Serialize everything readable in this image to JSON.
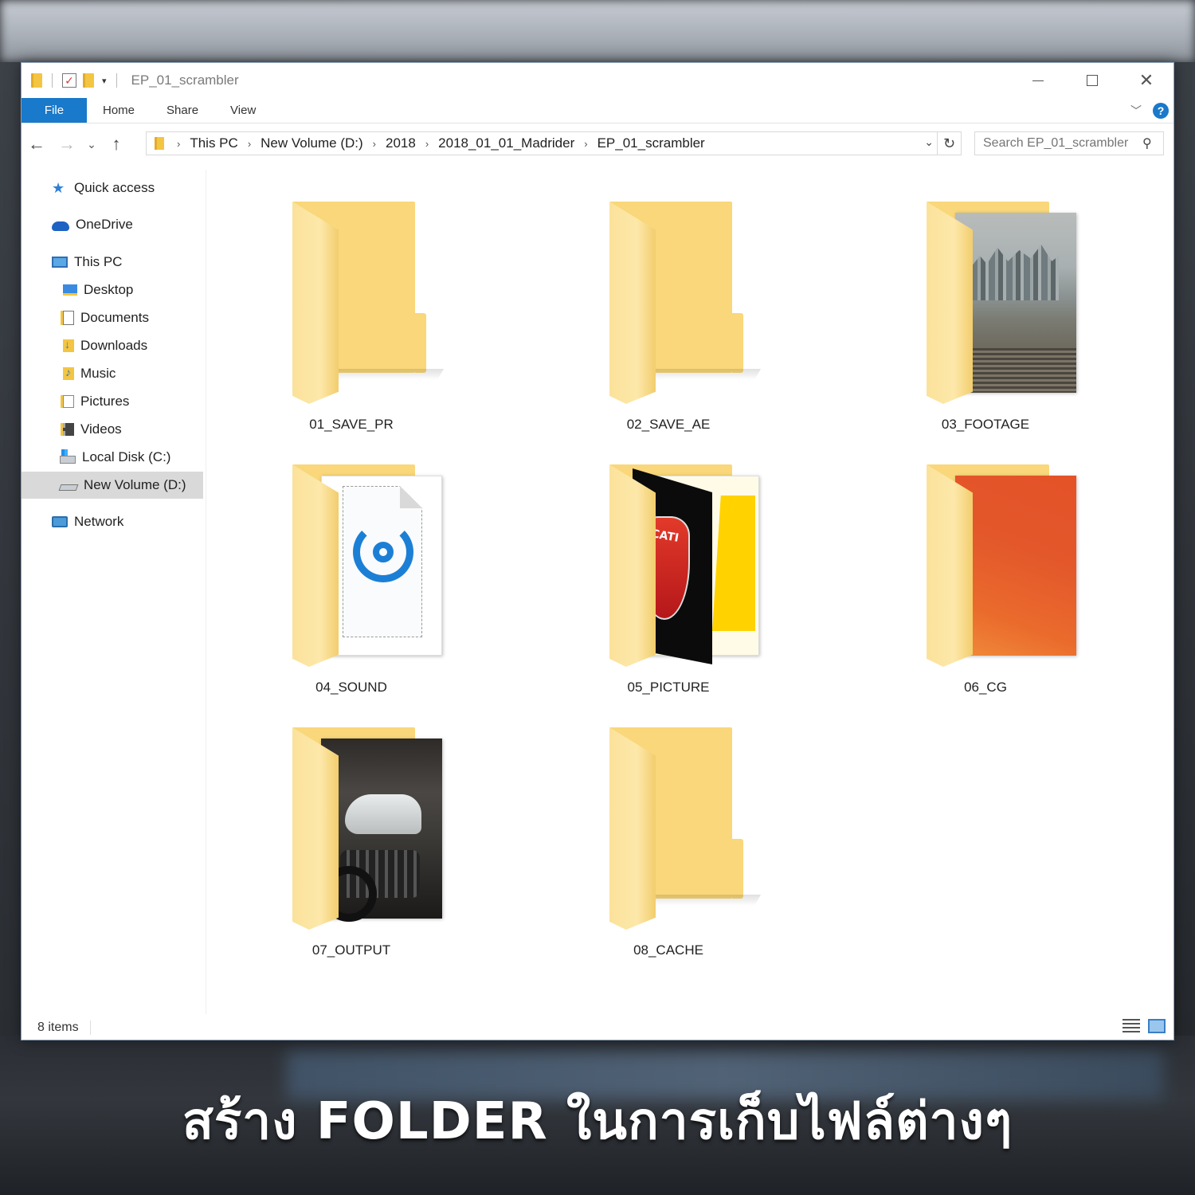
{
  "window": {
    "title": "EP_01_scrambler"
  },
  "ribbon": {
    "tabs": [
      "File",
      "Home",
      "Share",
      "View"
    ]
  },
  "address": {
    "crumbs": [
      "This PC",
      "New Volume (D:)",
      "2018",
      "2018_01_01_Madrider",
      "EP_01_scrambler"
    ]
  },
  "search": {
    "placeholder": "Search EP_01_scrambler"
  },
  "sidebar": {
    "items": [
      {
        "label": "Quick access",
        "icon": "quick-access-star-icon"
      },
      {
        "label": "OneDrive",
        "icon": "onedrive-cloud-icon"
      },
      {
        "label": "This PC",
        "icon": "this-pc-icon"
      },
      {
        "label": "Desktop",
        "icon": "desktop-folder-icon"
      },
      {
        "label": "Documents",
        "icon": "documents-folder-icon"
      },
      {
        "label": "Downloads",
        "icon": "downloads-folder-icon"
      },
      {
        "label": "Music",
        "icon": "music-folder-icon"
      },
      {
        "label": "Pictures",
        "icon": "pictures-folder-icon"
      },
      {
        "label": "Videos",
        "icon": "videos-folder-icon"
      },
      {
        "label": "Local Disk (C:)",
        "icon": "local-disk-icon"
      },
      {
        "label": "New Volume (D:)",
        "icon": "drive-icon",
        "selected": true
      },
      {
        "label": "Network",
        "icon": "network-icon"
      }
    ]
  },
  "content": {
    "folders": [
      {
        "name": "01_SAVE_PR",
        "thumbnail": "none"
      },
      {
        "name": "02_SAVE_AE",
        "thumbnail": "none"
      },
      {
        "name": "03_FOOTAGE",
        "thumbnail": "city-photo"
      },
      {
        "name": "04_SOUND",
        "thumbnail": "audio-document"
      },
      {
        "name": "05_PICTURE",
        "thumbnail": "ducati-logo"
      },
      {
        "name": "06_CG",
        "thumbnail": "orange-gradient"
      },
      {
        "name": "07_OUTPUT",
        "thumbnail": "motorcycle-photo"
      },
      {
        "name": "08_CACHE",
        "thumbnail": "none"
      }
    ]
  },
  "status": {
    "count": "8 items"
  },
  "caption": {
    "text": "สร้าง FOLDER ในการเก็บไฟล์ต่างๆ"
  },
  "colors": {
    "accent": "#1979ca",
    "folder": "#f9d77a",
    "selection": "#d9d9d9"
  }
}
